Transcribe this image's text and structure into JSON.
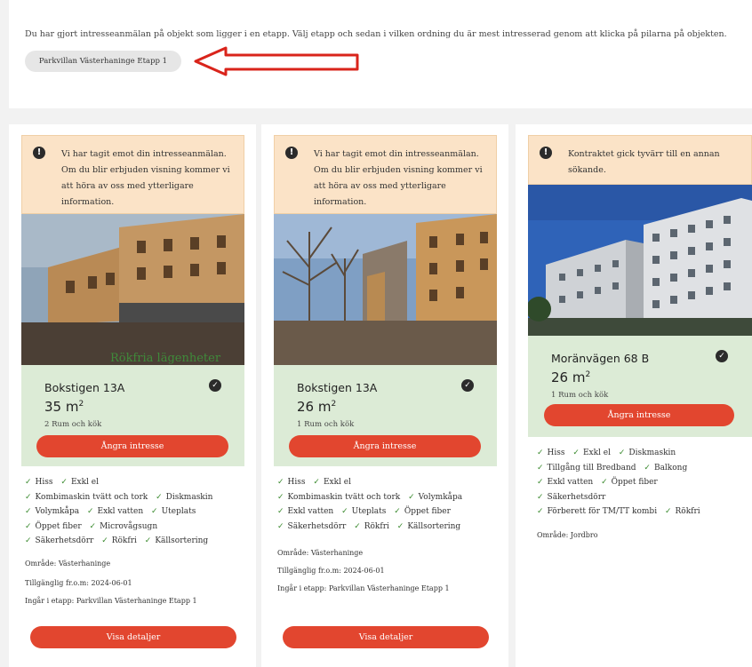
{
  "intro_text": "Du har gjort intresseanmälan på objekt som ligger i en etapp. Välj etapp och sedan i vilken ordning du är mest intresserad genom att klicka på pilarna på objekten.",
  "etapp_pill": "Parkvillan Västerhaninge Etapp 1",
  "accent_red": "#e2462f",
  "accent_green_bg": "#dcebd6",
  "alert_bg": "#fbe3c7",
  "cards": [
    {
      "alert": "Vi har tagit emot din intresseanmälan. Om du blir erbjuden visning kommer vi att höra av oss med ytterligare information.",
      "photo_watermark": "Rökfria lägenheter",
      "address": "Bokstigen 13A",
      "area": "35 m",
      "area_unit": "2",
      "rooms": "2 Rum och kök",
      "withdraw": "Ångra intresse",
      "features": [
        "Hiss",
        "Exkl el",
        "Kombimaskin tvätt och tork",
        "Diskmaskin",
        "Volymkåpa",
        "Exkl vatten",
        "Uteplats",
        "Öppet fiber",
        "Microvågsugn",
        "Säkerhetsdörr",
        "Rökfri",
        "Källsortering"
      ],
      "omrade": "Område: Västerhaninge",
      "tillganglig": "Tillgänglig fr.o.m: 2024-06-01",
      "etapp": "Ingår i etapp: Parkvillan Västerhaninge Etapp 1",
      "details": "Visa detaljer"
    },
    {
      "alert": "Vi har tagit emot din intresseanmälan. Om du blir erbjuden visning kommer vi att höra av oss med ytterligare information.",
      "address": "Bokstigen 13A",
      "area": "26 m",
      "area_unit": "2",
      "rooms": "1 Rum och kök",
      "withdraw": "Ångra intresse",
      "features": [
        "Hiss",
        "Exkl el",
        "Kombimaskin tvätt och tork",
        "Volymkåpa",
        "Exkl vatten",
        "Uteplats",
        "Öppet fiber",
        "Säkerhetsdörr",
        "Rökfri",
        "Källsortering"
      ],
      "omrade": "Område: Västerhaninge",
      "tillganglig": "Tillgänglig fr.o.m: 2024-06-01",
      "etapp": "Ingår i etapp: Parkvillan Västerhaninge Etapp 1",
      "details": "Visa detaljer"
    },
    {
      "alert": "Kontraktet gick tyvärr till en annan sökande.",
      "address": "Moränvägen 68 B",
      "area": "26 m",
      "area_unit": "2",
      "rooms": "1 Rum och kök",
      "withdraw": "Ångra intresse",
      "features": [
        "Hiss",
        "Exkl el",
        "Diskmaskin",
        "Tillgång till Bredband",
        "Balkong",
        "Exkl vatten",
        "Öppet fiber",
        "Säkerhetsdörr",
        "Förberett för TM/TT kombi",
        "Rökfri"
      ],
      "omrade": "Område: Jordbro"
    }
  ]
}
